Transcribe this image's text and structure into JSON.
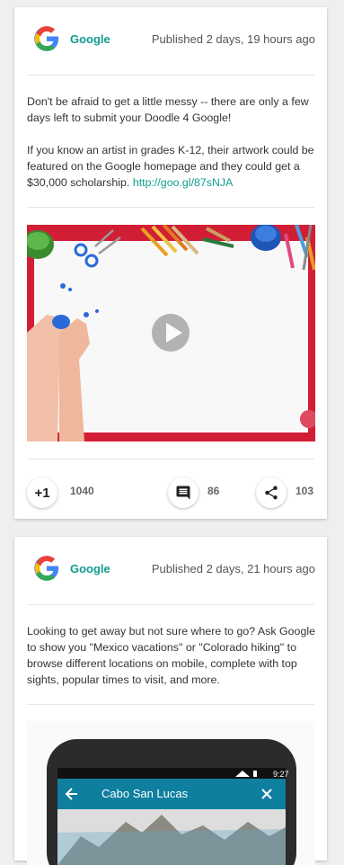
{
  "posts": [
    {
      "author": "Google",
      "published": "Published 2 days, 19 hours ago",
      "paragraph1": "Don't be afraid to get a little messy -- there are only a few days left to submit your Doodle 4 Google!",
      "paragraph2": "If you know an artist in grades K-12, their artwork could be featured on the Google homepage and they could get a $30,000 scholarship.",
      "link": "http://goo.gl/87sNJA",
      "plusone_label": "+1",
      "plusone_count": "1040",
      "comment_count": "86",
      "share_count": "103"
    },
    {
      "author": "Google",
      "published": "Published 2 days, 21 hours ago",
      "paragraph1": "Looking to get away but not sure where to go? Ask Google to show you \"Mexico vacations\" or \"Colorado hiking\" to browse different locations on mobile, complete with top sights, popular times to visit, and more.",
      "phone": {
        "time": "9:27",
        "title": "Cabo San Lucas"
      }
    }
  ],
  "colors": {
    "accent": "#0f9d8e",
    "background": "#efefef",
    "phone_appbar": "#0f7fa0"
  }
}
